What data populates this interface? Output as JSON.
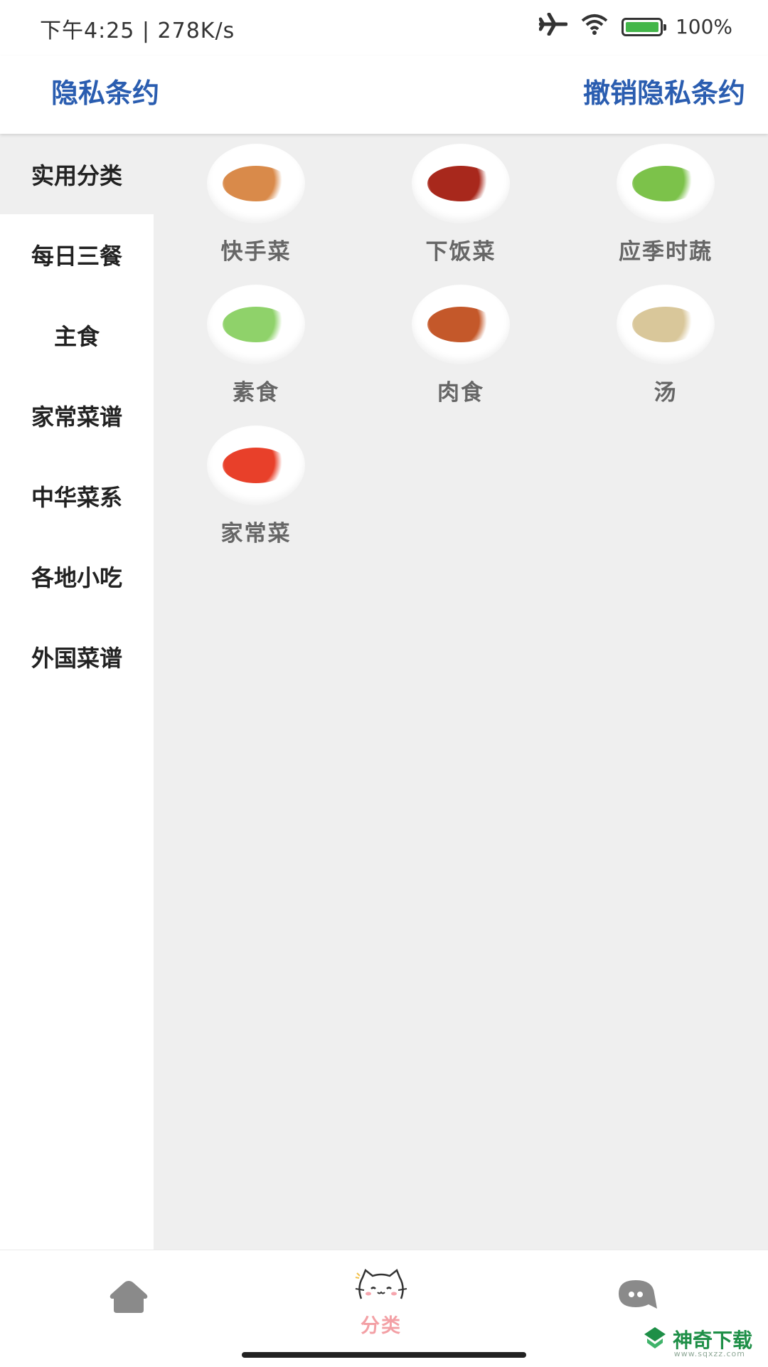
{
  "status_bar": {
    "time_speed": "下午4:25 | 278K/s",
    "battery_percent": "100%",
    "icons": [
      "airplane-icon",
      "wifi-icon",
      "battery-charging-icon"
    ]
  },
  "header": {
    "privacy_link": "隐私条约",
    "revoke_link": "撤销隐私条约",
    "link_color": "#2a5db0"
  },
  "sidebar": {
    "items": [
      {
        "label": "实用分类",
        "active": true
      },
      {
        "label": "每日三餐",
        "active": false
      },
      {
        "label": "主食",
        "active": false
      },
      {
        "label": "家常菜谱",
        "active": false
      },
      {
        "label": "中华菜系",
        "active": false
      },
      {
        "label": "各地小吃",
        "active": false
      },
      {
        "label": "外国菜谱",
        "active": false
      }
    ]
  },
  "categories": [
    {
      "label": "快手菜",
      "color": "#d98a4a"
    },
    {
      "label": "下饭菜",
      "color": "#a8281c"
    },
    {
      "label": "应季时蔬",
      "color": "#7cc24a"
    },
    {
      "label": "素食",
      "color": "#8fd26a"
    },
    {
      "label": "肉食",
      "color": "#c4582a"
    },
    {
      "label": "汤",
      "color": "#d9c79a"
    },
    {
      "label": "家常菜",
      "color": "#e8402a"
    }
  ],
  "bottom_nav": {
    "home_icon": "house-icon",
    "category_icon": "cat-face-icon",
    "category_label": "分类",
    "message_icon": "chat-bubble-icon",
    "active_color": "#f3a0a5"
  },
  "watermark": {
    "text": "神奇下载",
    "sub": "www.sqxzz.com"
  }
}
